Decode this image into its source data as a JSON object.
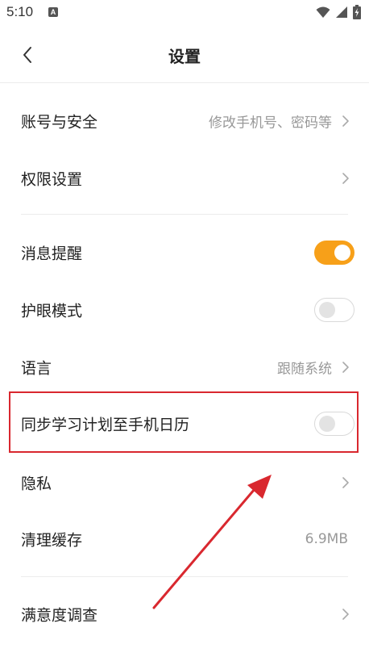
{
  "status_bar": {
    "time": "5:10",
    "notification_badge": "A",
    "icons": [
      "wifi-icon",
      "signal-icon",
      "battery-charging-icon"
    ]
  },
  "header": {
    "title": "设置",
    "back_icon": "chevron-left-icon"
  },
  "settings": {
    "account": {
      "label": "账号与安全",
      "value": "修改手机号、密码等"
    },
    "permissions": {
      "label": "权限设置"
    },
    "notifications": {
      "label": "消息提醒",
      "toggle": "on"
    },
    "eye_care": {
      "label": "护眼模式",
      "toggle": "off"
    },
    "language": {
      "label": "语言",
      "value": "跟随系统"
    },
    "calendar_sync": {
      "label": "同步学习计划至手机日历",
      "toggle": "off"
    },
    "privacy": {
      "label": "隐私"
    },
    "cache": {
      "label": "清理缓存",
      "value": "6.9MB"
    },
    "survey": {
      "label": "满意度调查"
    }
  },
  "colors": {
    "accent": "#f7a019",
    "annotation": "#d9282f",
    "secondary_text": "#999999",
    "divider": "#ececec"
  }
}
